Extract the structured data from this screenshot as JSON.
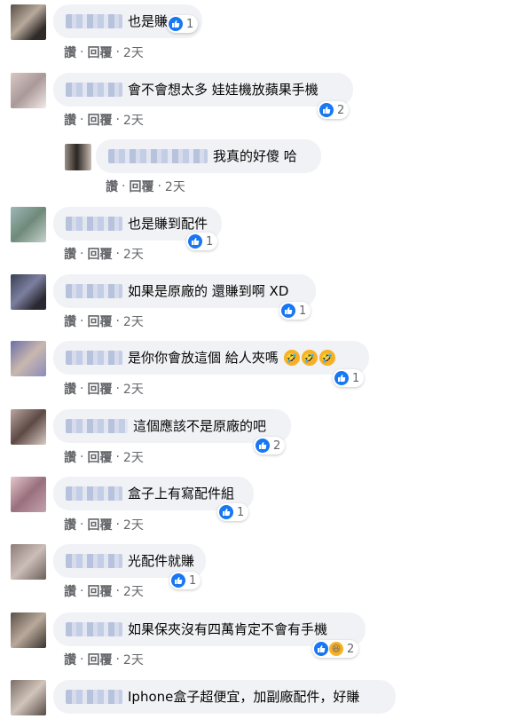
{
  "actions": {
    "like": "讚",
    "reply": "回覆",
    "sep": "·"
  },
  "colors": {
    "like_blue": "#1877f2",
    "bubble_bg": "#f0f2f5",
    "meta_gray": "#65676b",
    "haha_yellow": "#f7b125"
  },
  "comments": [
    {
      "text": "也是賺",
      "reactions": "1",
      "time": "2天"
    },
    {
      "text": "會不會想太多 娃娃機放蘋果手機",
      "reactions": "2",
      "time": "2天"
    },
    {
      "text": "我真的好傻 哈",
      "reactions": "",
      "time": "2天"
    },
    {
      "text": "也是賺到配件",
      "reactions": "1",
      "time": "2天"
    },
    {
      "text": "如果是原廠的 還賺到啊 XD",
      "reactions": "1",
      "time": "2天"
    },
    {
      "text": "是你你會放這個 給人夾嗎",
      "reactions": "1",
      "time": "2天"
    },
    {
      "text": "這個應該不是原廠的吧",
      "reactions": "2",
      "time": "2天"
    },
    {
      "text": "盒子上有寫配件組",
      "reactions": "1",
      "time": "2天"
    },
    {
      "text": "光配件就賺",
      "reactions": "1",
      "time": "2天"
    },
    {
      "text": "如果保夾沒有四萬肯定不會有手機",
      "reactions": "2",
      "time": "2天"
    },
    {
      "text": "Iphone盒子超便宜，加副廠配件，好賺",
      "reactions": "",
      "time": ""
    }
  ]
}
